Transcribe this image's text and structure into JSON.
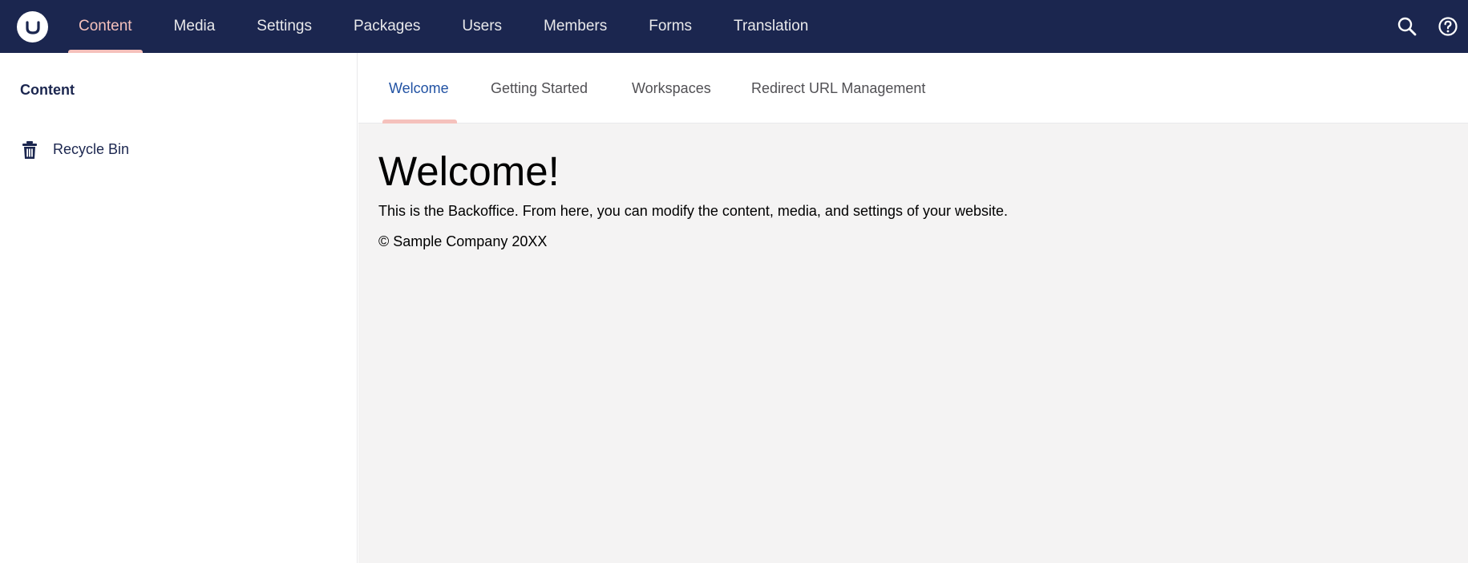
{
  "header": {
    "logo_icon": "umbraco-logo-icon",
    "nav": [
      {
        "label": "Content",
        "active": true
      },
      {
        "label": "Media"
      },
      {
        "label": "Settings"
      },
      {
        "label": "Packages"
      },
      {
        "label": "Users"
      },
      {
        "label": "Members"
      },
      {
        "label": "Forms"
      },
      {
        "label": "Translation"
      }
    ],
    "tools": [
      "search-icon",
      "help-icon"
    ]
  },
  "sidebar": {
    "title": "Content",
    "items": [
      {
        "label": "Recycle Bin",
        "icon": "trash-icon"
      }
    ]
  },
  "main": {
    "tabs": [
      {
        "label": "Welcome",
        "active": true
      },
      {
        "label": "Getting Started"
      },
      {
        "label": "Workspaces"
      },
      {
        "label": "Redirect URL Management"
      }
    ],
    "welcome": {
      "title": "Welcome!",
      "text": "This is the Backoffice. From here, you can modify the content, media, and settings of your website.",
      "copyright": "© Sample Company 20XX"
    }
  },
  "colors": {
    "header_bg": "#1b264f",
    "accent": "#f5c1bc",
    "active_tab": "#2152a3",
    "main_bg": "#f4f3f3"
  }
}
